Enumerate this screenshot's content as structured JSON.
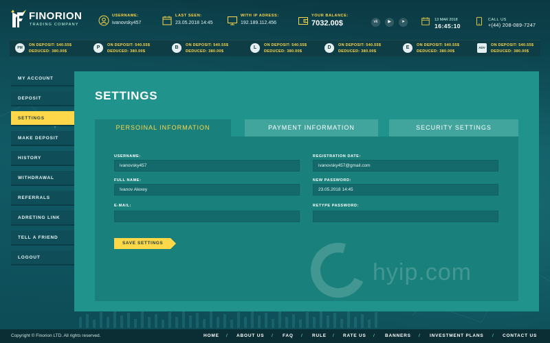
{
  "brand": {
    "name": "FINORION",
    "subtitle": "TRADING COMPANY"
  },
  "header": {
    "username_label": "USERNAME:",
    "username_value": "ivanovsky457",
    "last_seen_label": "LAST SEEN:",
    "last_seen_value": "23.05.2018 14:45",
    "ip_label": "WITH IP ADRESS:",
    "ip_value": "192.189.112.456",
    "balance_label": "YOUR BALANCE:",
    "balance_value": "7032.00$",
    "date": "13 MAR 2018",
    "time": "16:45:10",
    "call_label": "CALL US",
    "call_number": "+(44) 208-089-7247",
    "socials": [
      "vk-icon",
      "youtube-icon",
      "telegram-icon"
    ]
  },
  "ticker": [
    {
      "coin": "PM",
      "deposit": "ON DEPOSIT: 540.55$",
      "deduced": "DEDUCED: 380.00$"
    },
    {
      "coin": "P",
      "deposit": "ON DEPOSIT: 540.55$",
      "deduced": "DEDUCED: 380.00$"
    },
    {
      "coin": "B",
      "deposit": "ON DEPOSIT: 540.55$",
      "deduced": "DEDUCED: 380.00$"
    },
    {
      "coin": "L",
      "deposit": "ON DEPOSIT: 540.55$",
      "deduced": "DEDUCED: 380.00$"
    },
    {
      "coin": "D",
      "deposit": "ON DEPOSIT: 540.55$",
      "deduced": "DEDUCED: 380.00$"
    },
    {
      "coin": "E",
      "deposit": "ON DEPOSIT: 540.55$",
      "deduced": "DEDUCED: 380.00$"
    },
    {
      "coin": "ADV",
      "deposit": "ON DEPOSIT: 540.55$",
      "deduced": "DEDUCED: 380.00$"
    }
  ],
  "sidebar": {
    "items": [
      {
        "label": "MY ACCOUNT"
      },
      {
        "label": "DEPOSIT"
      },
      {
        "label": "SETTINGS"
      },
      {
        "label": "MAKE DEPOSIT"
      },
      {
        "label": "HISTORY"
      },
      {
        "label": "WITHDRAWAL"
      },
      {
        "label": "REFERRALS"
      },
      {
        "label": "ADRETING LINK"
      },
      {
        "label": "TELL A FRIEND"
      },
      {
        "label": "LOGOUT"
      }
    ],
    "active": "SETTINGS"
  },
  "main": {
    "title": "SETTINGS",
    "tabs": [
      {
        "label": "PERSOINAL INFORMATION"
      },
      {
        "label": "PAYMENT INFORMATION"
      },
      {
        "label": "SECURITY SETTINGS"
      }
    ],
    "form": {
      "username_label": "USERNAME:",
      "username_value": "ivanovsky457",
      "fullname_label": "FULL NAME:",
      "fullname_value": "Ivanov Alexey",
      "email_label": "E-MAIL:",
      "email_value": "",
      "regdate_label": "REGISTRATION DATE:",
      "regdate_value": "ivanovsky457@gmail.com",
      "newpass_label": "NEW PASSWORD:",
      "newpass_value": "23.05.2018 14:45",
      "retype_label": "RETYPE PASSWORD:",
      "retype_value": "",
      "save_label": "SAVE SETTINGS"
    },
    "watermark": "hyip.com"
  },
  "footer": {
    "copyright": "Copyright © Finorion LTD. All rights reserved.",
    "nav": [
      "HOME",
      "ABOUT US",
      "FAQ",
      "RULE",
      "RATE US",
      "BANNERS",
      "INVESTMENT PLANS",
      "CONTACT US"
    ]
  },
  "colors": {
    "accent": "#ffd84a",
    "panel": "#1f938c",
    "sidebar": "#0f4e58"
  }
}
